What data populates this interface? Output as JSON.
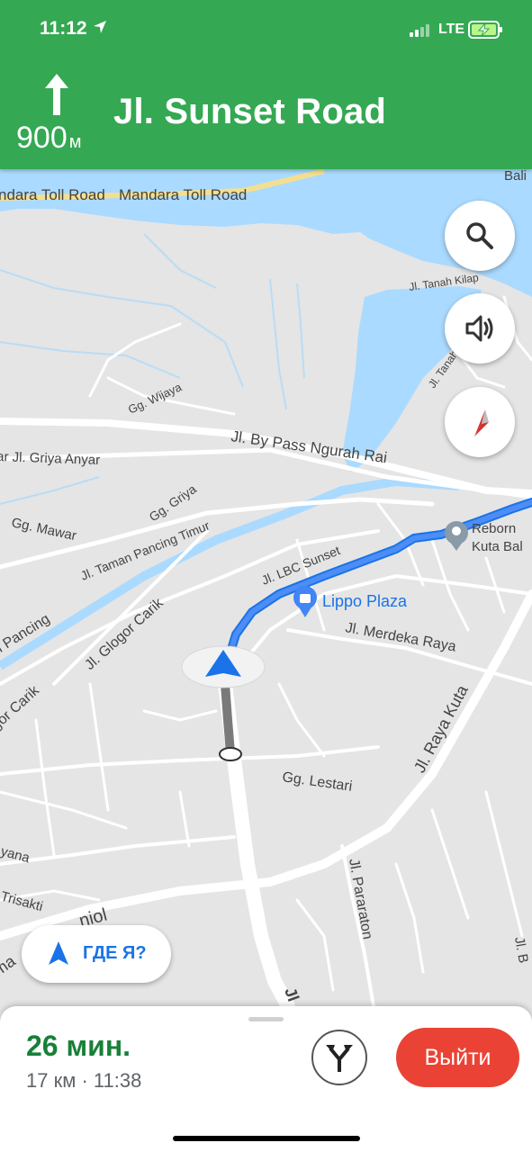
{
  "status_bar": {
    "time": "11:12",
    "network": "LTE"
  },
  "navigation": {
    "distance": "900",
    "distance_unit": "м",
    "street": "Jl. Sunset Road"
  },
  "map": {
    "labels": {
      "toll_road_1": "ndara Toll Road",
      "toll_road_2": "Mandara Toll Road",
      "bali": "Bali",
      "tanah_kilap": "Jl. Tanah Kilap",
      "tanah_cut": "Jl. Tanah",
      "wijaya": "Gg. Wijaya",
      "bypass": "Jl. By Pass Ngurah Rai",
      "griya_anyar": "ar Jl. Griya Anyar",
      "griya": "Gg. Griya",
      "mawar": "Gg. Mawar",
      "taman_pancing_timur": "Jl. Taman Pancing Timur",
      "lbc_sunset": "Jl. LBC Sunset",
      "reborn": "Reborn",
      "kuta_bali": "Kuta Bal",
      "lippo": "Lippo Plaza",
      "merdeka": "Jl. Merdeka Raya",
      "pancing": "n Pancing",
      "glogor_carik": "Jl. Glogor Carik",
      "gor_carik": "gor Carik",
      "raya_kuta": "Jl. Raya Kuta",
      "lestari": "Gg. Lestari",
      "yana": "yana",
      "trisakti": "Trisakti",
      "niol": "niol",
      "pararaton": "Jl. Pararaton",
      "ma": "ma",
      "jl_b": "Jl. B",
      "jl_bottom": "Jl"
    }
  },
  "controls": {
    "where_am_i": "ГДЕ Я?"
  },
  "bottom_panel": {
    "eta": "26 мин.",
    "summary": "17 км · 11:38",
    "exit_label": "Выйти"
  },
  "colors": {
    "header": "#34a853",
    "route": "#4285f4",
    "eta": "#188038",
    "exit": "#ea4335",
    "water": "#aadaff"
  }
}
